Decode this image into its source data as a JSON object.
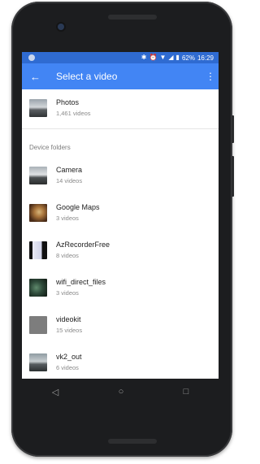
{
  "status_bar": {
    "battery_percent": "62%",
    "time": "16:29"
  },
  "app_bar": {
    "title": "Select a video"
  },
  "top_item": {
    "title": "Photos",
    "subtitle": "1,461 videos"
  },
  "device_folders": {
    "header": "Device folders",
    "items": [
      {
        "title": "Camera",
        "subtitle": "14 videos"
      },
      {
        "title": "Google Maps",
        "subtitle": "3 videos"
      },
      {
        "title": "AzRecorderFree",
        "subtitle": "8 videos"
      },
      {
        "title": "wifi_direct_files",
        "subtitle": "3 videos"
      },
      {
        "title": "videokit",
        "subtitle": "15 videos"
      },
      {
        "title": "vk2_out",
        "subtitle": "6 videos"
      }
    ]
  },
  "nav_icons": {
    "back": "◁",
    "home": "○",
    "recents": "□"
  },
  "colors": {
    "app_bar": "#4285f4",
    "status_bar": "#2f6bd1"
  }
}
